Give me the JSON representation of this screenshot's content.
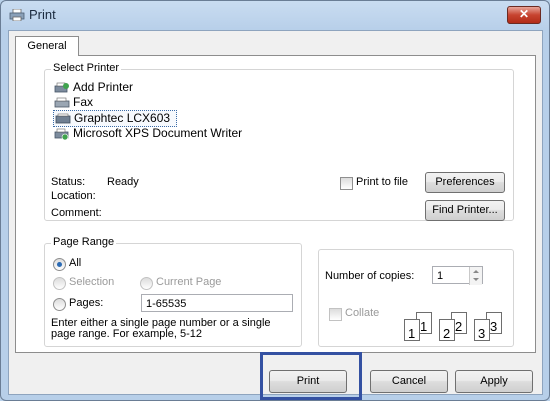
{
  "window": {
    "title": "Print",
    "close_label": "✕"
  },
  "tabs": [
    {
      "label": "General"
    }
  ],
  "select_printer": {
    "title": "Select Printer",
    "printers": [
      {
        "name": "Add Printer",
        "icon": "add-printer-icon"
      },
      {
        "name": "Fax",
        "icon": "fax-printer-icon"
      },
      {
        "name": "Graphtec LCX603",
        "icon": "printer-icon",
        "selected": true
      },
      {
        "name": "Microsoft XPS Document Writer",
        "icon": "xps-printer-icon"
      }
    ],
    "status_label": "Status:",
    "status_value": "Ready",
    "location_label": "Location:",
    "comment_label": "Comment:",
    "print_to_file_label": "Print to file",
    "print_to_file_checked": false,
    "preferences_label": "Preferences",
    "find_printer_label": "Find Printer..."
  },
  "page_range": {
    "title": "Page Range",
    "all_label": "All",
    "selection_label": "Selection",
    "current_page_label": "Current Page",
    "pages_label": "Pages:",
    "pages_value": "1-65535",
    "selected_option": "All",
    "hint": "Enter either a single page number or a single page range.  For example, 5-12"
  },
  "copies": {
    "label": "Number of copies:",
    "value": "1",
    "collate_label": "Collate",
    "collate_checked": false,
    "collate_pages": [
      "1",
      "1",
      "2",
      "2",
      "3",
      "3"
    ]
  },
  "buttons": {
    "print": "Print",
    "cancel": "Cancel",
    "apply": "Apply"
  },
  "colors": {
    "highlight_border": "#3451a2",
    "selected_radio": "#2c6bb4"
  }
}
